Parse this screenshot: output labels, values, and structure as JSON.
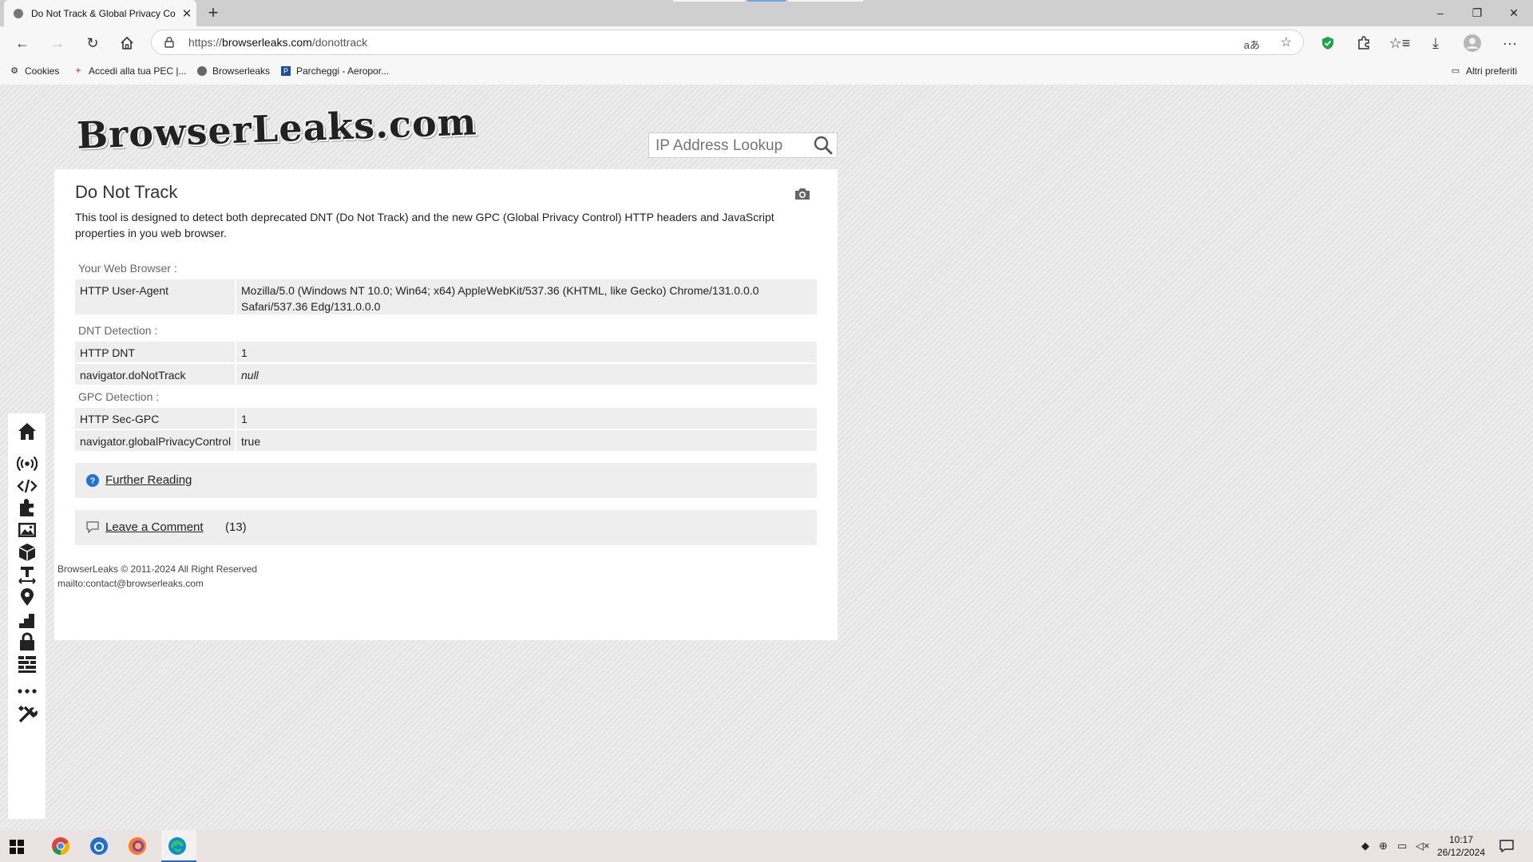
{
  "browser": {
    "tab_title": "Do Not Track & Global Privacy Co",
    "url_scheme": "https://",
    "url_host": "browserleaks.com",
    "url_path": "/donottrack",
    "bookmarks": [
      {
        "label": "Cookies",
        "icon": "gear-icon"
      },
      {
        "label": "Accedi alla tua PEC |...",
        "icon": "plus-icon"
      },
      {
        "label": "Browserleaks",
        "icon": "browserleaks-icon"
      },
      {
        "label": "Parcheggi - Aeropor...",
        "icon": "parking-icon"
      }
    ],
    "other_favorites": "Altri preferiti"
  },
  "site": {
    "logo_text": "BrowserLeaks.com",
    "search_placeholder": "IP Address Lookup"
  },
  "main": {
    "title": "Do Not Track",
    "description": "This tool is designed to detect both deprecated DNT (Do Not Track) and the new GPC (Global Privacy Control) HTTP headers and JavaScript properties in you web browser.",
    "sections": [
      {
        "heading": "Your Web Browser :",
        "rows": [
          {
            "key": "HTTP User-Agent",
            "value_line1": "Mozilla/5.0 (Windows NT 10.0; Win64; x64) AppleWebKit/537.36 (KHTML, like Gecko) Chrome/131.0.0.0",
            "value_line2": "Safari/537.36 Edg/131.0.0.0"
          }
        ]
      },
      {
        "heading": "DNT Detection :",
        "rows": [
          {
            "key": "HTTP DNT",
            "value": "1"
          },
          {
            "key": "navigator.doNotTrack",
            "value": "null"
          }
        ]
      },
      {
        "heading": "GPC Detection :",
        "rows": [
          {
            "key": "HTTP Sec-GPC",
            "value": "1"
          },
          {
            "key": "navigator.globalPrivacyControl",
            "value": "true"
          }
        ]
      }
    ],
    "further_reading": "Further Reading",
    "leave_comment": "Leave a Comment",
    "comment_count": "(13)"
  },
  "footer": {
    "copyright": "BrowserLeaks © 2011-2024 All Right Reserved",
    "contact": "mailto:contact@browserleaks.com"
  },
  "sidebar_icons": [
    "home-icon",
    "antenna-icon",
    "code-icon",
    "puzzle-icon",
    "image-icon",
    "cube-icon",
    "text-width-icon",
    "location-pin-icon",
    "stairs-icon",
    "lock-icon",
    "grid-icon",
    "more-icon",
    "tools-icon"
  ],
  "taskbar": {
    "time": "10:17",
    "date": "26/12/2024"
  },
  "colors": {
    "accent": "#1e6fd9",
    "help_icon": "#1e73d8",
    "shield": "#1fa44b"
  }
}
